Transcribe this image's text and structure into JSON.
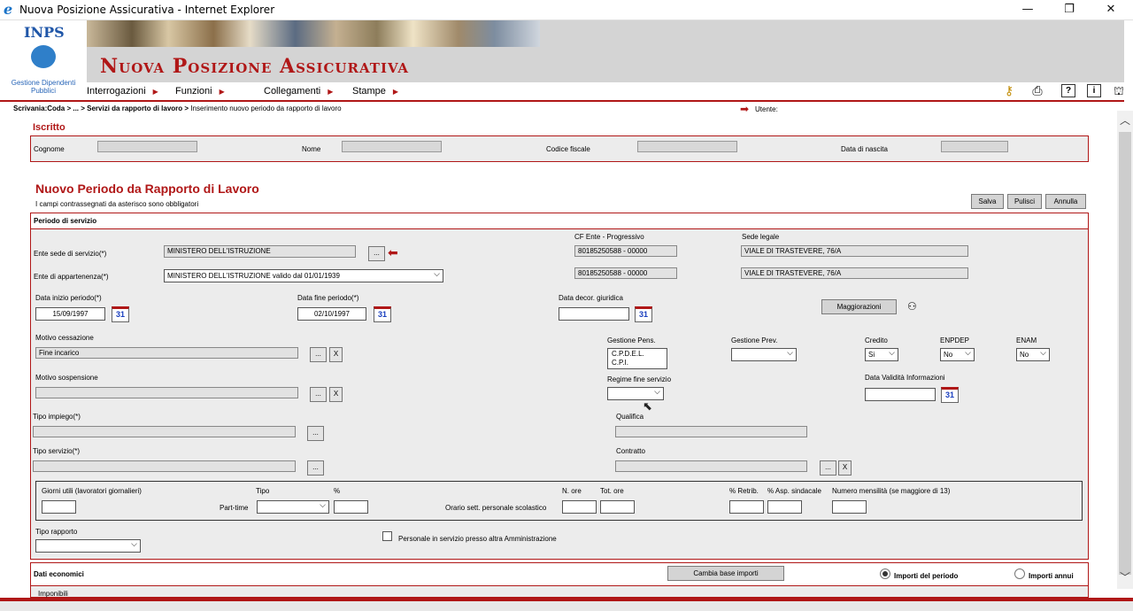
{
  "window": {
    "title": "Nuova Posizione Assicurativa - Internet Explorer",
    "minimize": "—",
    "restore": "❐",
    "close": "✕"
  },
  "header": {
    "logo_text": "INPS",
    "logo_caption": "Gestione Dipendenti Pubblici",
    "app_title": "Nuova Posizione Assicurativa",
    "menu": [
      "Interrogazioni",
      "Funzioni",
      "Collegamenti",
      "Stampe"
    ],
    "toolbar_icons": [
      "key-icon",
      "printer-icon",
      "help-icon",
      "info-icon",
      "network-icon"
    ],
    "toolbar_glyphs": {
      "key": "⚷",
      "print": "⎙",
      "help": "?",
      "info": "i",
      "net": "⛫"
    }
  },
  "breadcrumb": {
    "bold": "Scrivania:Coda > ... > Servizi da rapporto di lavoro >",
    "rest": " Inserimento nuovo periodo da rapporto di lavoro"
  },
  "utente_label": "Utente:",
  "iscritto": {
    "title": "Iscritto",
    "cognome_label": "Cognome",
    "nome_label": "Nome",
    "codice_fiscale_label": "Codice fiscale",
    "data_nascita_label": "Data di nascita"
  },
  "form": {
    "title": "Nuovo Periodo da Rapporto di Lavoro",
    "subtitle": "I campi contrassegnati da asterisco sono obbligatori",
    "buttons": {
      "salva": "Salva",
      "pulisci": "Pulisci",
      "annulla": "Annulla"
    }
  },
  "periodo": {
    "title": "Periodo di servizio",
    "cf_ente_label": "CF Ente - Progressivo",
    "sede_legale_label": "Sede legale",
    "ente_sede_label": "Ente sede di servizio(*)",
    "ente_sede_value": "MINISTERO DELL'ISTRUZIONE",
    "ente_sede_btn": "...",
    "cf_ente_1": "80185250588 - 00000",
    "sede_legale_1": "VIALE DI TRASTEVERE, 76/A",
    "ente_app_label": "Ente di appartenenza(*)",
    "ente_app_value": "MINISTERO DELL'ISTRUZIONE valido dal 01/01/1939",
    "cf_ente_2": "80185250588 - 00000",
    "sede_legale_2": "VIALE DI TRASTEVERE, 76/A",
    "data_inizio_label": "Data inizio periodo(*)",
    "data_inizio_value": "15/09/1997",
    "data_fine_label": "Data fine periodo(*)",
    "data_fine_value": "02/10/1997",
    "data_decor_label": "Data decor. giuridica",
    "data_decor_value": "",
    "cal_text": "31",
    "maggiorazioni": "Maggiorazioni",
    "motivo_cessazione_label": "Motivo cessazione",
    "motivo_cessazione_value": "Fine incarico",
    "motivo_sospensione_label": "Motivo sospensione",
    "gestione_pens_label": "Gestione Pens.",
    "gestione_pens_options": [
      "C.P.D.E.L.",
      "C.P.I."
    ],
    "gestione_prev_label": "Gestione Prev.",
    "gestione_prev_value": "",
    "credito_label": "Credito",
    "credito_value": "Si",
    "enpdep_label": "ENPDEP",
    "enpdep_value": "No",
    "enam_label": "ENAM",
    "enam_value": "No",
    "regime_label": "Regime fine servizio",
    "regime_value": "",
    "data_validita_label": "Data Validità Informazioni",
    "data_validita_value": "",
    "tipo_impiego_label": "Tipo impiego(*)",
    "qualifica_label": "Qualifica",
    "tipo_servizio_label": "Tipo servizio(*)",
    "contratto_label": "Contratto",
    "btn_dots": "...",
    "btn_x": "X"
  },
  "orario": {
    "giorni_label": "Giorni utili (lavoratori giornalieri)",
    "tipo_label": "Tipo",
    "perc_label": "%",
    "part_time_label": "Part-time",
    "n_ore_label": "N. ore",
    "tot_ore_label": "Tot. ore",
    "orario_label": "Orario sett. personale scolastico",
    "retrib_label": "% Retrib.",
    "asp_label": "% Asp. sindacale",
    "mensilita_label": "Numero mensilità (se maggiore di 13)"
  },
  "tipo_rapporto_label": "Tipo rapporto",
  "personale_label": "Personale in servizio presso altra Amministrazione",
  "dati_economici": {
    "title": "Dati economici",
    "cambia_btn": "Cambia base importi",
    "importi_periodo": "Importi del periodo",
    "importi_annui": "Importi annui",
    "imponibili": "Imponibili"
  }
}
